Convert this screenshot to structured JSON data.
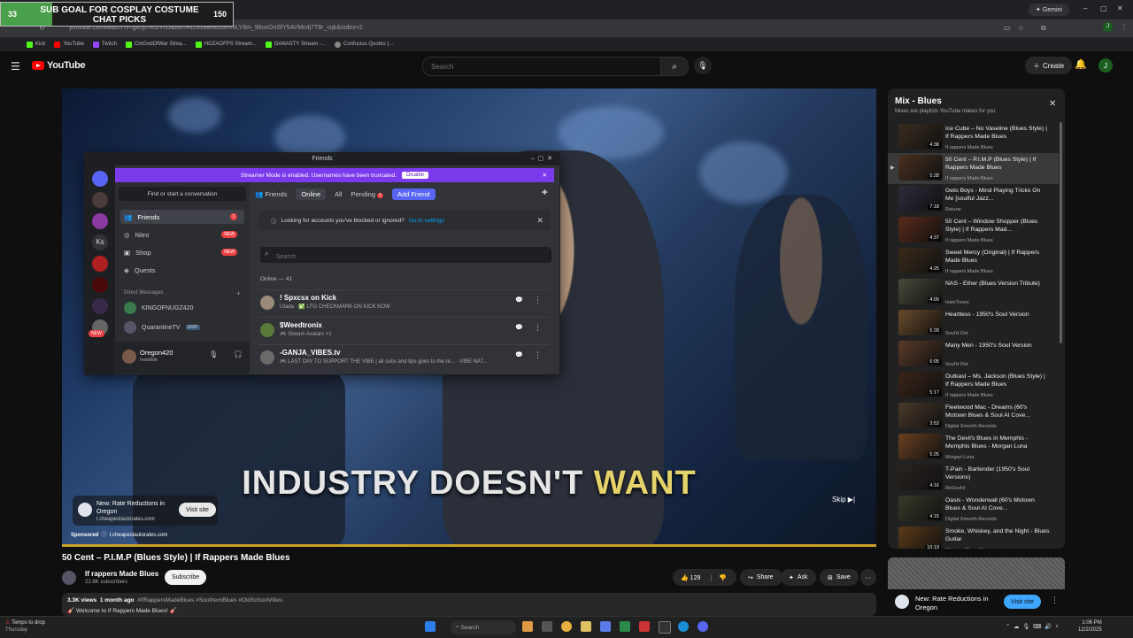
{
  "browser": {
    "url": "youtube.com/watch?v=gxcjs7KOYcU&list=RDJGMEM3sRVvLY6m_96uxOnSfY5AVMc4j7T8r_cqk&index=2",
    "gemini_label": "Gemini",
    "bookmarks": [
      "Kick",
      "YouTube",
      "Twitch",
      "CmGodOfWar Strea...",
      "HOZAOFPS Stream...",
      "GANASTY Stream -...",
      "Confucius Quotes (..."
    ]
  },
  "goal_overlay": {
    "current": "33",
    "title": "SUB GOAL FOR COSPLAY COSTUME CHAT PICKS",
    "target": "150",
    "progress_fraction": 0.22
  },
  "youtube": {
    "logo_text": "YouTube",
    "search_placeholder": "Search",
    "create_label": "Create",
    "avatar_letter": "J"
  },
  "video": {
    "caption_part1": "INDUSTRY DOESN'T ",
    "caption_highlight": "WANT",
    "ad": {
      "title": "New: Rate Reductions in Oregon",
      "url": "t.cheapestautorates.com",
      "visit_label": "Visit site",
      "sponsored_label": "Sponsored",
      "sponsored_url": "t.cheapestautorates.com"
    },
    "skip_label": "Skip"
  },
  "discord": {
    "window_title": "Friends",
    "banner_text": "Streamer Mode is enabled. Usernames have been truncated.",
    "banner_disable": "Disable",
    "find_placeholder": "Find or start a conversation",
    "nav": [
      {
        "label": "Friends",
        "badge": "1"
      },
      {
        "label": "Nitro",
        "badge": "NEW"
      },
      {
        "label": "Shop",
        "badge": "NEW"
      },
      {
        "label": "Quests",
        "badge": ""
      }
    ],
    "direct_messages_label": "Direct Messages",
    "dms": [
      {
        "name": "KINGOFNUGZ420"
      },
      {
        "name": "QuarantineTV",
        "tag": "DRIP"
      }
    ],
    "user": {
      "name": "Oregon420",
      "status": "Invisible"
    },
    "tabs": {
      "friends": "Friends",
      "online": "Online",
      "all": "All",
      "pending": "Pending",
      "pending_count": "1",
      "add_friend": "Add Friend"
    },
    "notice_text": "Looking for accounts you've blocked or ignored?",
    "notice_link": "Go to settings",
    "search_placeholder": "Search",
    "online_label": "Online — 41",
    "friends": [
      {
        "name": "! Spxcsx on Kick",
        "status": "Utada · ✅ LFG CHECKMARK ON KICK NOW"
      },
      {
        "name": "$Weedtronix",
        "status": "🎮 Stream Avatars +1"
      },
      {
        "name": "-GANJA_VIBES.tv",
        "status": "🎮 LAST DAY TO SUPPORT THE VIBE | all subs and tips goes to the re... · VIBE NAT..."
      }
    ],
    "server_initial": "Ks",
    "rail_new": "NEW"
  },
  "playlist": {
    "title": "Mix - Blues",
    "subtitle": "Mixes are playlists YouTube makes for you",
    "items": [
      {
        "title": "Ice Cube – No Vaseline (Blues Style) | If Rappers Made Blues",
        "channel": "If rappers Made Blues",
        "duration": "4:38",
        "color": "#3a2c1f"
      },
      {
        "title": "50 Cent – P.I.M.P (Blues Style) | If Rappers Made Blues",
        "channel": "If rappers Made Blues",
        "duration": "5:28",
        "color": "#4a3020"
      },
      {
        "title": "Geto Boys - Mind Playing Tricks On Me [soulful Jazz...",
        "channel": "Retune",
        "duration": "7:18",
        "color": "#2f2a3a"
      },
      {
        "title": "50 Cent – Window Shopper (Blues Style) | If Rappers Mad...",
        "channel": "If rappers Made Blues",
        "duration": "4:37",
        "color": "#5a2a1a"
      },
      {
        "title": "Sweet Mercy (Original) | If Rappers Made Blues",
        "channel": "If rappers Made Blues",
        "duration": "4:25",
        "color": "#3a2a1a"
      },
      {
        "title": "NAS - Ether (Blues Version Tribute)",
        "channel": "IvainTunes",
        "duration": "4:09",
        "color": "#4a4a3a"
      },
      {
        "title": "Heartless - 1950's Soul Version",
        "channel": "Soul'd Out",
        "duration": "5:28",
        "color": "#6a4a2a"
      },
      {
        "title": "Many Men - 1950's Soul Version",
        "channel": "Soul'd Out",
        "duration": "6:05",
        "color": "#5a3a2a"
      },
      {
        "title": "Outkast – Ms. Jackson (Blues Style) | If Rappers Made Blues",
        "channel": "If rappers Made Blues",
        "duration": "5:17",
        "color": "#3a2418"
      },
      {
        "title": "Fleetwood Mac - Dreams (60's Motown Blues & Soul AI Cove...",
        "channel": "Digital Smooth Records",
        "duration": "3:53",
        "color": "#4a3a2a"
      },
      {
        "title": "The Devil's Blues in Memphis - Memphis Blues - Morgan Luna",
        "channel": "Morgan Luna",
        "duration": "5:25",
        "color": "#6a4020"
      },
      {
        "title": "T-Pain - Bartender (1950's Soul Versions)",
        "channel": "ReSoul'd",
        "duration": "4:16",
        "color": "#2a2420"
      },
      {
        "title": "Oasis - Wonderwall (60's Motown Blues & Soul AI Cove...",
        "channel": "Digital Smooth Records",
        "duration": "4:15",
        "color": "#3a3a2a"
      },
      {
        "title": "Smoke, Whiskey, and the Night - Blues Guitar",
        "channel": "Whiskey Blues Music",
        "duration": "10:19",
        "color": "#5a3a18"
      }
    ]
  },
  "below_video": {
    "title": "50 Cent – P.I.M.P (Blues Style) | If Rappers Made Blues",
    "channel": "If rappers Made Blues",
    "subscribers": "22.8K subscribers",
    "subscribe_label": "Subscribe",
    "likes": "129",
    "share_label": "Share",
    "ask_label": "Ask",
    "save_label": "Save",
    "views": "3.3K views",
    "date": "1 month ago",
    "hashtags": "#IfRappersMadeBlues #SouthernBlues #OldSchoolVibes",
    "desc_line": "Welcome to If Rappers Made Blues!"
  },
  "side_ad": {
    "title": "New: Rate Reductions in Oregon",
    "visit_label": "Visit site"
  },
  "taskbar": {
    "weather_title": "Temps to drop",
    "weather_sub": "Thursday",
    "search_label": "Search",
    "time": "1:06 PM",
    "date": "12/2/2025"
  }
}
